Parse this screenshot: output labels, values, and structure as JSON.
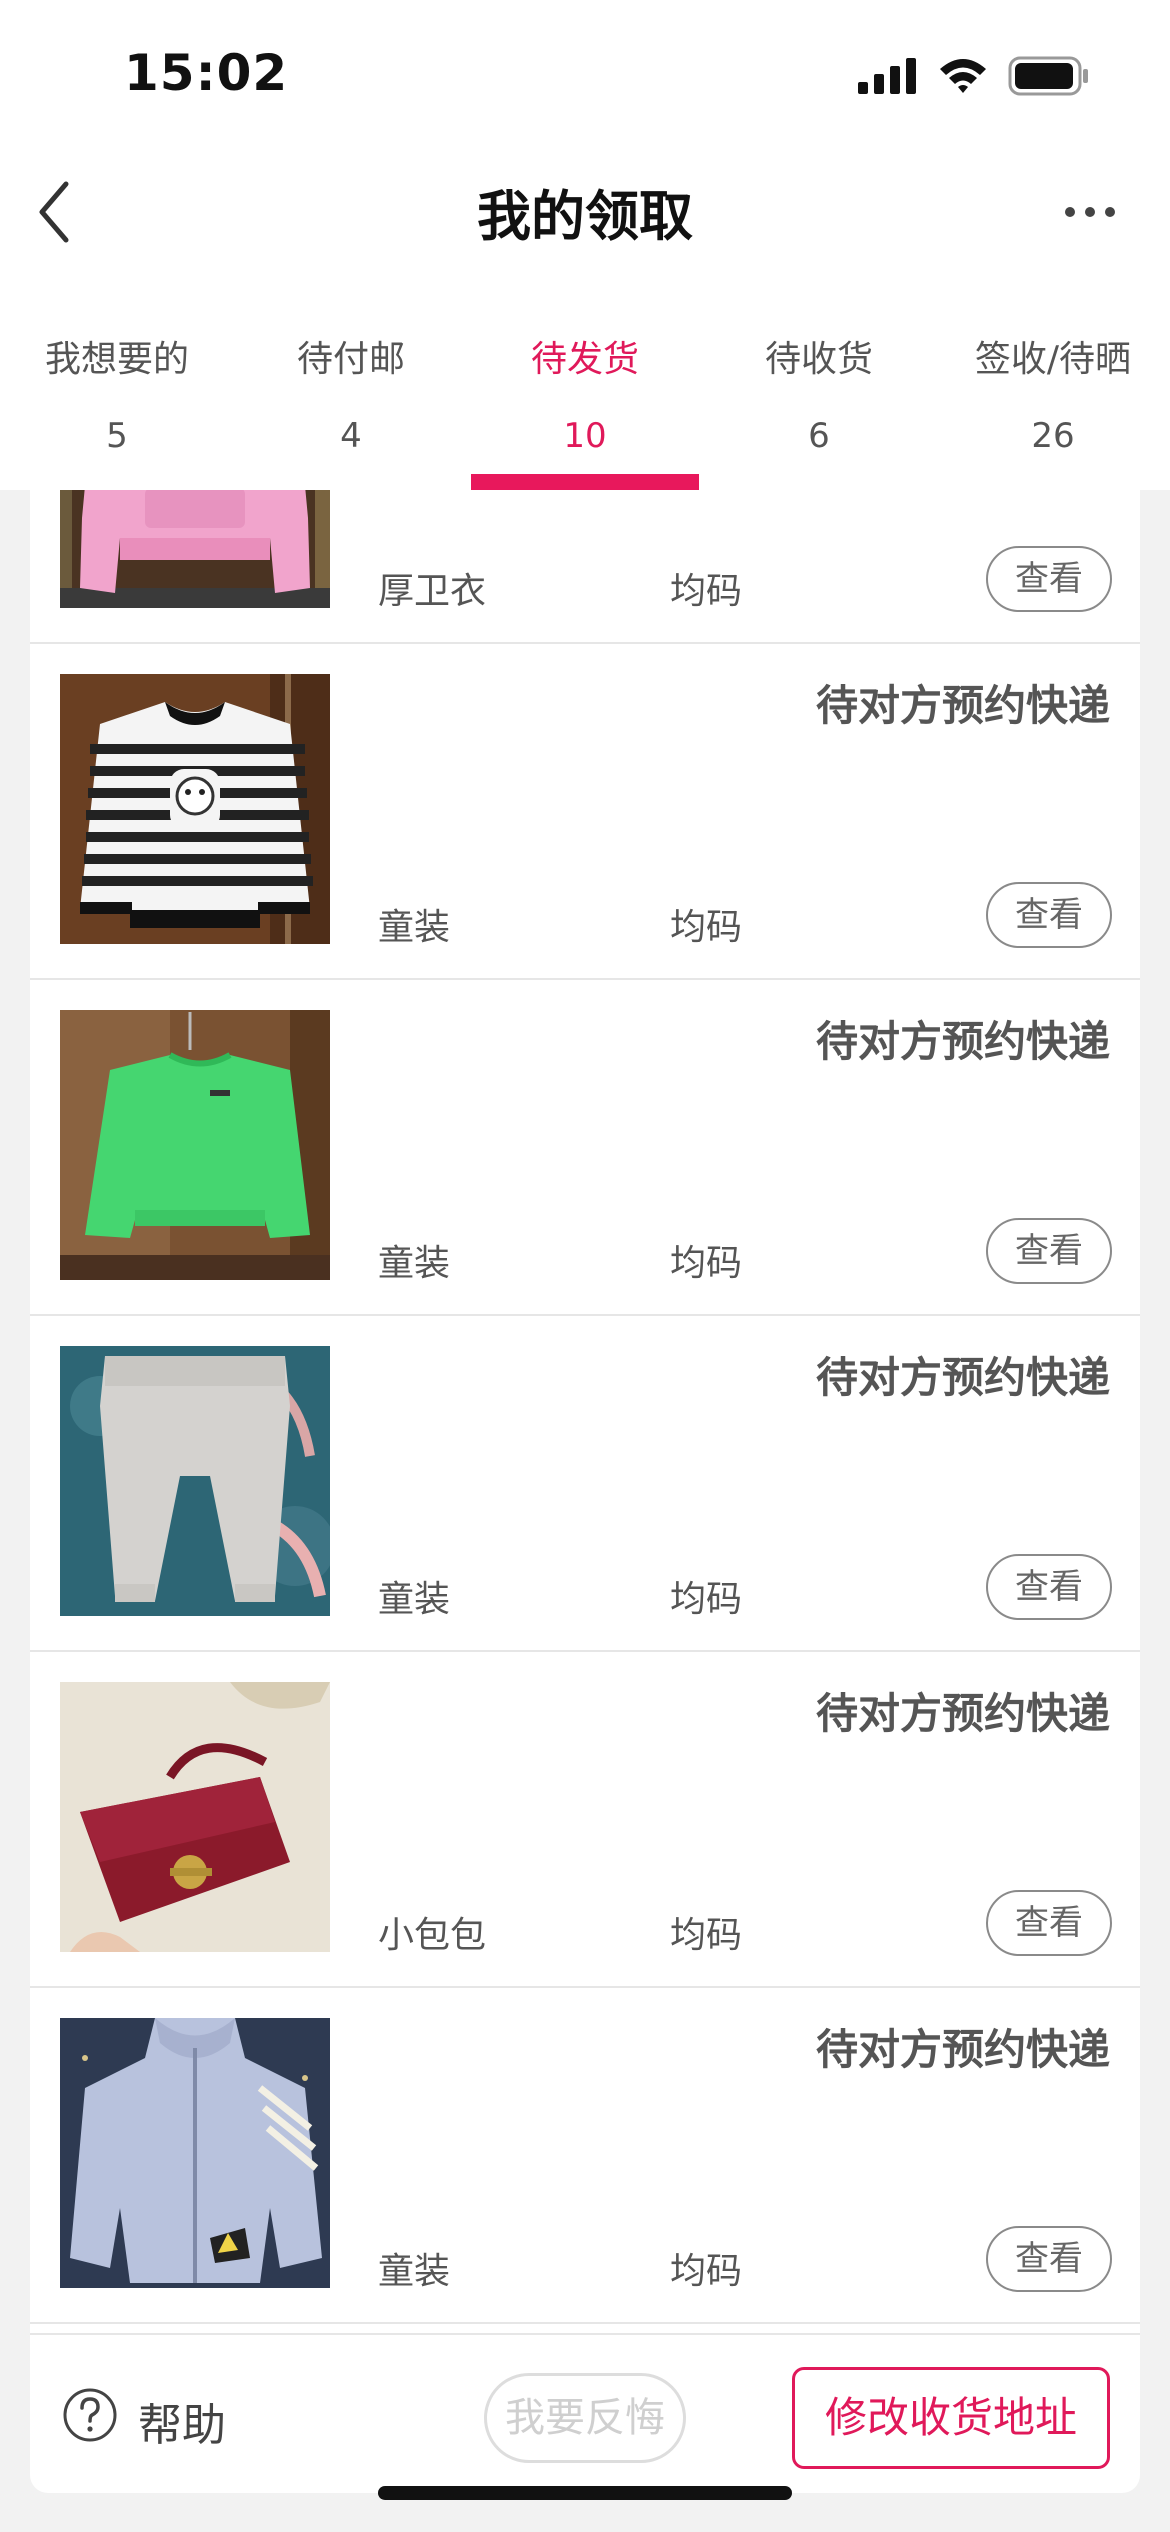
{
  "status_bar": {
    "time": "15:02"
  },
  "nav": {
    "title": "我的领取"
  },
  "tabs": [
    {
      "label": "我想要的",
      "count": "5"
    },
    {
      "label": "待付邮",
      "count": "4"
    },
    {
      "label": "待发货",
      "count": "10",
      "active": true
    },
    {
      "label": "待收货",
      "count": "6"
    },
    {
      "label": "签收/待晒",
      "count": "26"
    }
  ],
  "items": [
    {
      "status": "",
      "name": "厚卫衣",
      "size": "均码",
      "view_label": "查看",
      "image": "pink-hoodie"
    },
    {
      "status": "待对方预约快递",
      "name": "童装",
      "size": "均码",
      "view_label": "查看",
      "image": "striped-sweater"
    },
    {
      "status": "待对方预约快递",
      "name": "童装",
      "size": "均码",
      "view_label": "查看",
      "image": "green-sweatshirt"
    },
    {
      "status": "待对方预约快递",
      "name": "童装",
      "size": "均码",
      "view_label": "查看",
      "image": "grey-pants"
    },
    {
      "status": "待对方预约快递",
      "name": "小包包",
      "size": "均码",
      "view_label": "查看",
      "image": "red-handbag"
    },
    {
      "status": "待对方预约快递",
      "name": "童装",
      "size": "均码",
      "view_label": "查看",
      "image": "lilac-jacket"
    }
  ],
  "bottom": {
    "help_label": "帮助",
    "regret_label": "我要反悔",
    "address_label": "修改收货地址"
  },
  "colors": {
    "accent": "#e0195a"
  }
}
